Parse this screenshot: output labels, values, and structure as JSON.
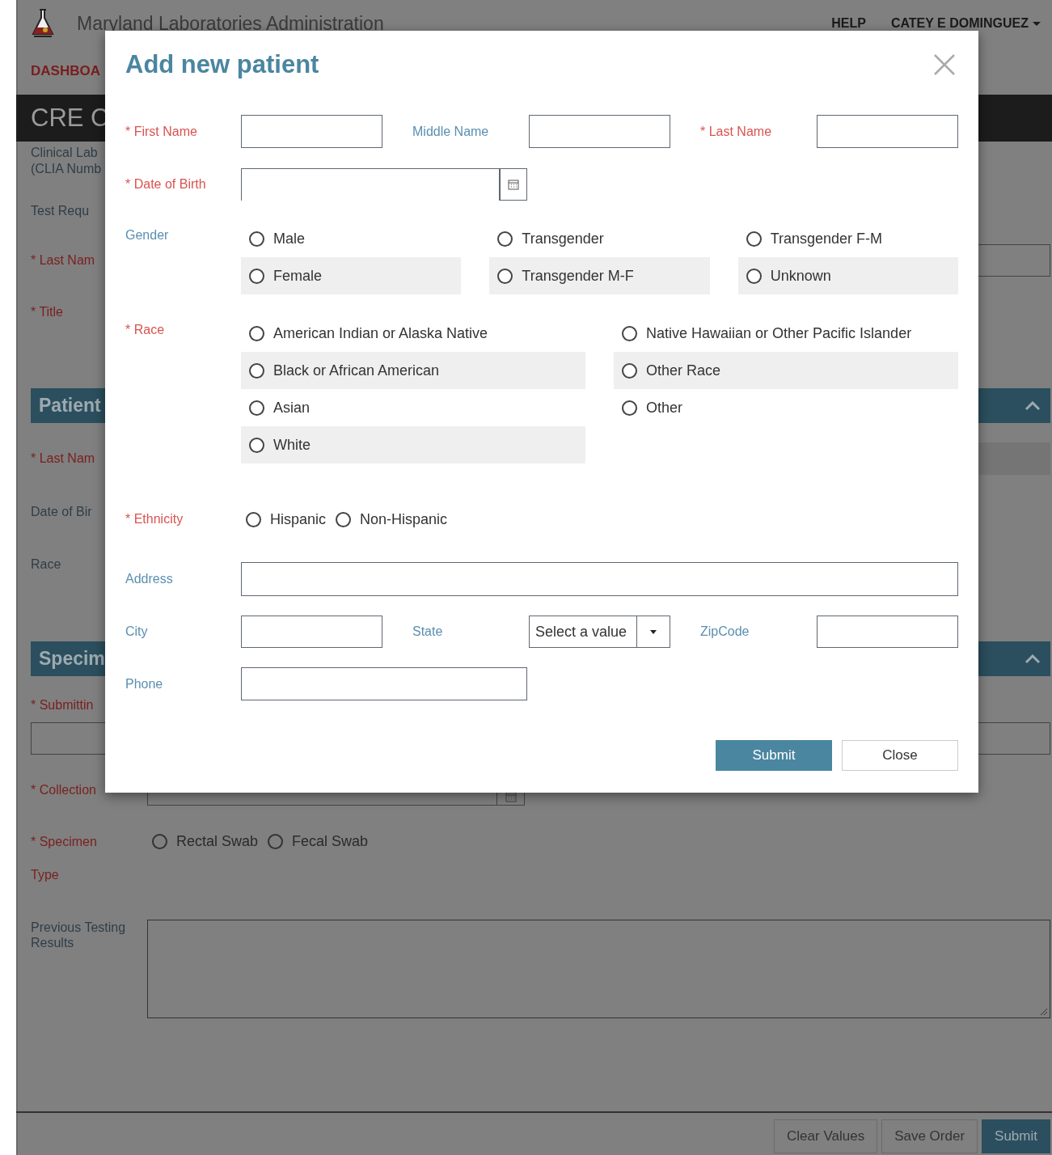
{
  "background": {
    "app_title": "Maryland Laboratories Administration",
    "help_link": "HELP",
    "user_menu": "CATEY E DOMINGUEZ",
    "nav_tab": "DASHBOA",
    "page_title": "CRE C",
    "lab_info": [
      "Clinical Lab",
      "(CLIA Numb"
    ],
    "rows": [
      {
        "kind": "text",
        "label": "Test Requ",
        "required": false
      },
      {
        "kind": "field",
        "label": "* Last Nam",
        "required": true
      },
      {
        "kind": "text",
        "label": "* Title",
        "required": true
      },
      {
        "kind": "section",
        "label": "Patient"
      },
      {
        "kind": "grey-field",
        "label": "* Last Nam",
        "required": true
      },
      {
        "kind": "text",
        "label": "Date of Bir",
        "required": false
      },
      {
        "kind": "text",
        "label": "Race",
        "required": false
      },
      {
        "kind": "section",
        "label": "Specim"
      },
      {
        "kind": "text",
        "label": "* Submittin",
        "required": true
      },
      {
        "kind": "wide-field"
      },
      {
        "kind": "date",
        "label": "* Collection",
        "required": true
      },
      {
        "kind": "radios",
        "label": "* Specimen Type",
        "required": true,
        "options": [
          {
            "label": "Rectal Swab",
            "selected": false
          },
          {
            "label": "Fecal Swab",
            "selected": false
          }
        ]
      },
      {
        "kind": "textarea",
        "label": "Previous Testing Results",
        "required": false
      }
    ],
    "footer_buttons": [
      {
        "label": "Clear Values",
        "primary": false
      },
      {
        "label": "Save Order",
        "primary": false
      },
      {
        "label": "Submit",
        "primary": true
      }
    ]
  },
  "dialog": {
    "title": "Add new patient",
    "name_fields": [
      {
        "label": "* First Name",
        "required": true
      },
      {
        "label": "Middle Name",
        "required": false
      },
      {
        "label": "* Last Name",
        "required": true
      }
    ],
    "date_of_birth": {
      "label": "* Date of Birth",
      "required": true
    },
    "gender": {
      "label": "Gender",
      "required": false,
      "options": [
        {
          "label": "Male",
          "selected": false
        },
        {
          "label": "Transgender",
          "selected": false
        },
        {
          "label": "Transgender F-M",
          "selected": false
        },
        {
          "label": "Female",
          "selected": false
        },
        {
          "label": "Transgender M-F",
          "selected": false
        },
        {
          "label": "Unknown",
          "selected": false
        }
      ]
    },
    "race": {
      "label": "* Race",
      "required": true,
      "options": [
        {
          "label": "American Indian or Alaska Native",
          "selected": false
        },
        {
          "label": "Native Hawaiian or Other Pacific Islander",
          "selected": false
        },
        {
          "label": "Black or African American",
          "selected": false
        },
        {
          "label": "Other Race",
          "selected": false
        },
        {
          "label": "Asian",
          "selected": false
        },
        {
          "label": "Other",
          "selected": false
        },
        {
          "label": "White",
          "selected": false
        }
      ]
    },
    "ethnicity": {
      "label": "* Ethnicity",
      "required": true,
      "options": [
        {
          "label": "Hispanic",
          "selected": false
        },
        {
          "label": "Non-Hispanic",
          "selected": false
        }
      ]
    },
    "address": {
      "label": "Address",
      "required": false
    },
    "city": {
      "label": "City",
      "required": false
    },
    "state": {
      "label": "State",
      "required": false,
      "value": "Select a value"
    },
    "zipcode": {
      "label": "ZipCode",
      "required": false
    },
    "phone": {
      "label": "Phone",
      "required": false
    },
    "buttons": [
      {
        "label": "Submit",
        "primary": true
      },
      {
        "label": "Close",
        "primary": false
      }
    ]
  }
}
